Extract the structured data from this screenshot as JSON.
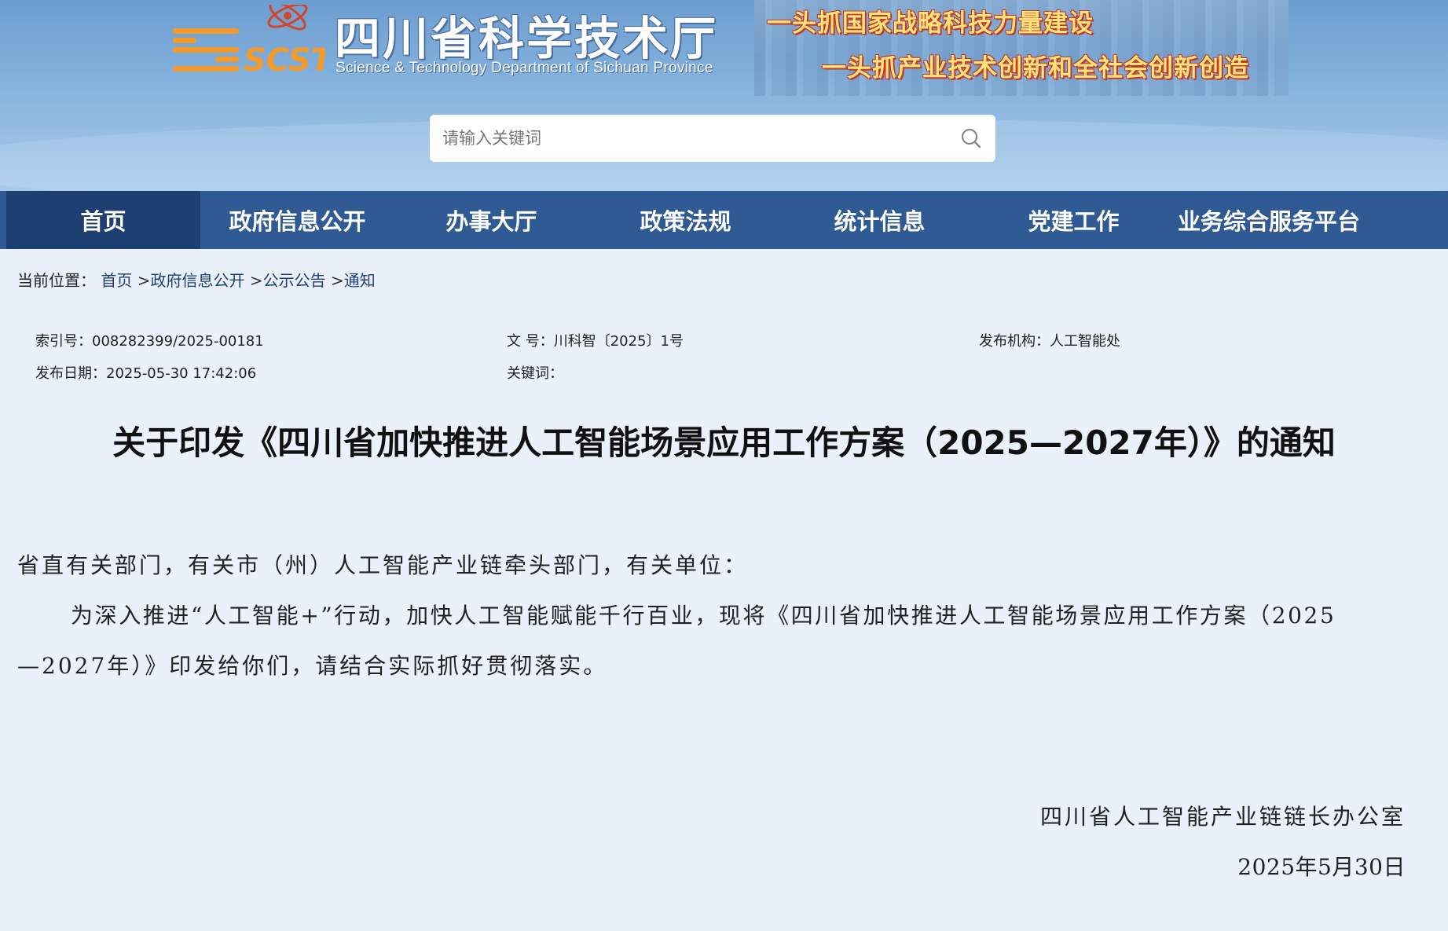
{
  "header": {
    "logo_title": "四川省科学技术厅",
    "logo_subtitle": "Science & Technology Department of Sichuan Province",
    "logo_letters": "SCST",
    "slogan_1": "一头抓国家战略科技力量建设",
    "slogan_2": "一头抓产业技术创新和全社会创新创造"
  },
  "search": {
    "placeholder": "请输入关键词",
    "icon": "search-icon"
  },
  "nav": {
    "items": [
      {
        "label": "首页",
        "active": true
      },
      {
        "label": "政府信息公开"
      },
      {
        "label": "办事大厅"
      },
      {
        "label": "政策法规"
      },
      {
        "label": "统计信息"
      },
      {
        "label": "党建工作"
      },
      {
        "label": "业务综合服务平台"
      }
    ]
  },
  "breadcrumb": {
    "prefix": "当前位置：",
    "items": [
      "首页",
      "政府信息公开",
      "公示公告",
      "通知"
    ],
    "separator": ">"
  },
  "meta": {
    "index_label": "索引号：",
    "index_value": "008282399/2025-00181",
    "docno_label": "文 号：",
    "docno_value": "川科智〔2025〕1号",
    "org_label": "发布机构：",
    "org_value": "人工智能处",
    "date_label": "发布日期：",
    "date_value": "2025-05-30 17:42:06",
    "keywords_label": "关键词：",
    "keywords_value": ""
  },
  "document": {
    "title": "关于印发《四川省加快推进人工智能场景应用工作方案（2025—2027年）》的通知",
    "salutation": "省直有关部门，有关市（州）人工智能产业链牵头部门，有关单位：",
    "paragraph_line_1": "为深入推进“人工智能+”行动，加快人工智能赋能千行百业，现将《四川省加快推进人工智能场景应用工作方案（2025",
    "paragraph_line_2": "—2027年）》印发给你们，请结合实际抓好贯彻落实。",
    "signature": "四川省人工智能产业链链长办公室",
    "date": "2025年5月30日"
  },
  "colors": {
    "nav_bg": "#2f5a94",
    "nav_active_bg": "#1d3f72",
    "page_bg": "#eaf1fb",
    "slogan_fill": "#ffe27a",
    "slogan_outline": "#c0392b"
  }
}
